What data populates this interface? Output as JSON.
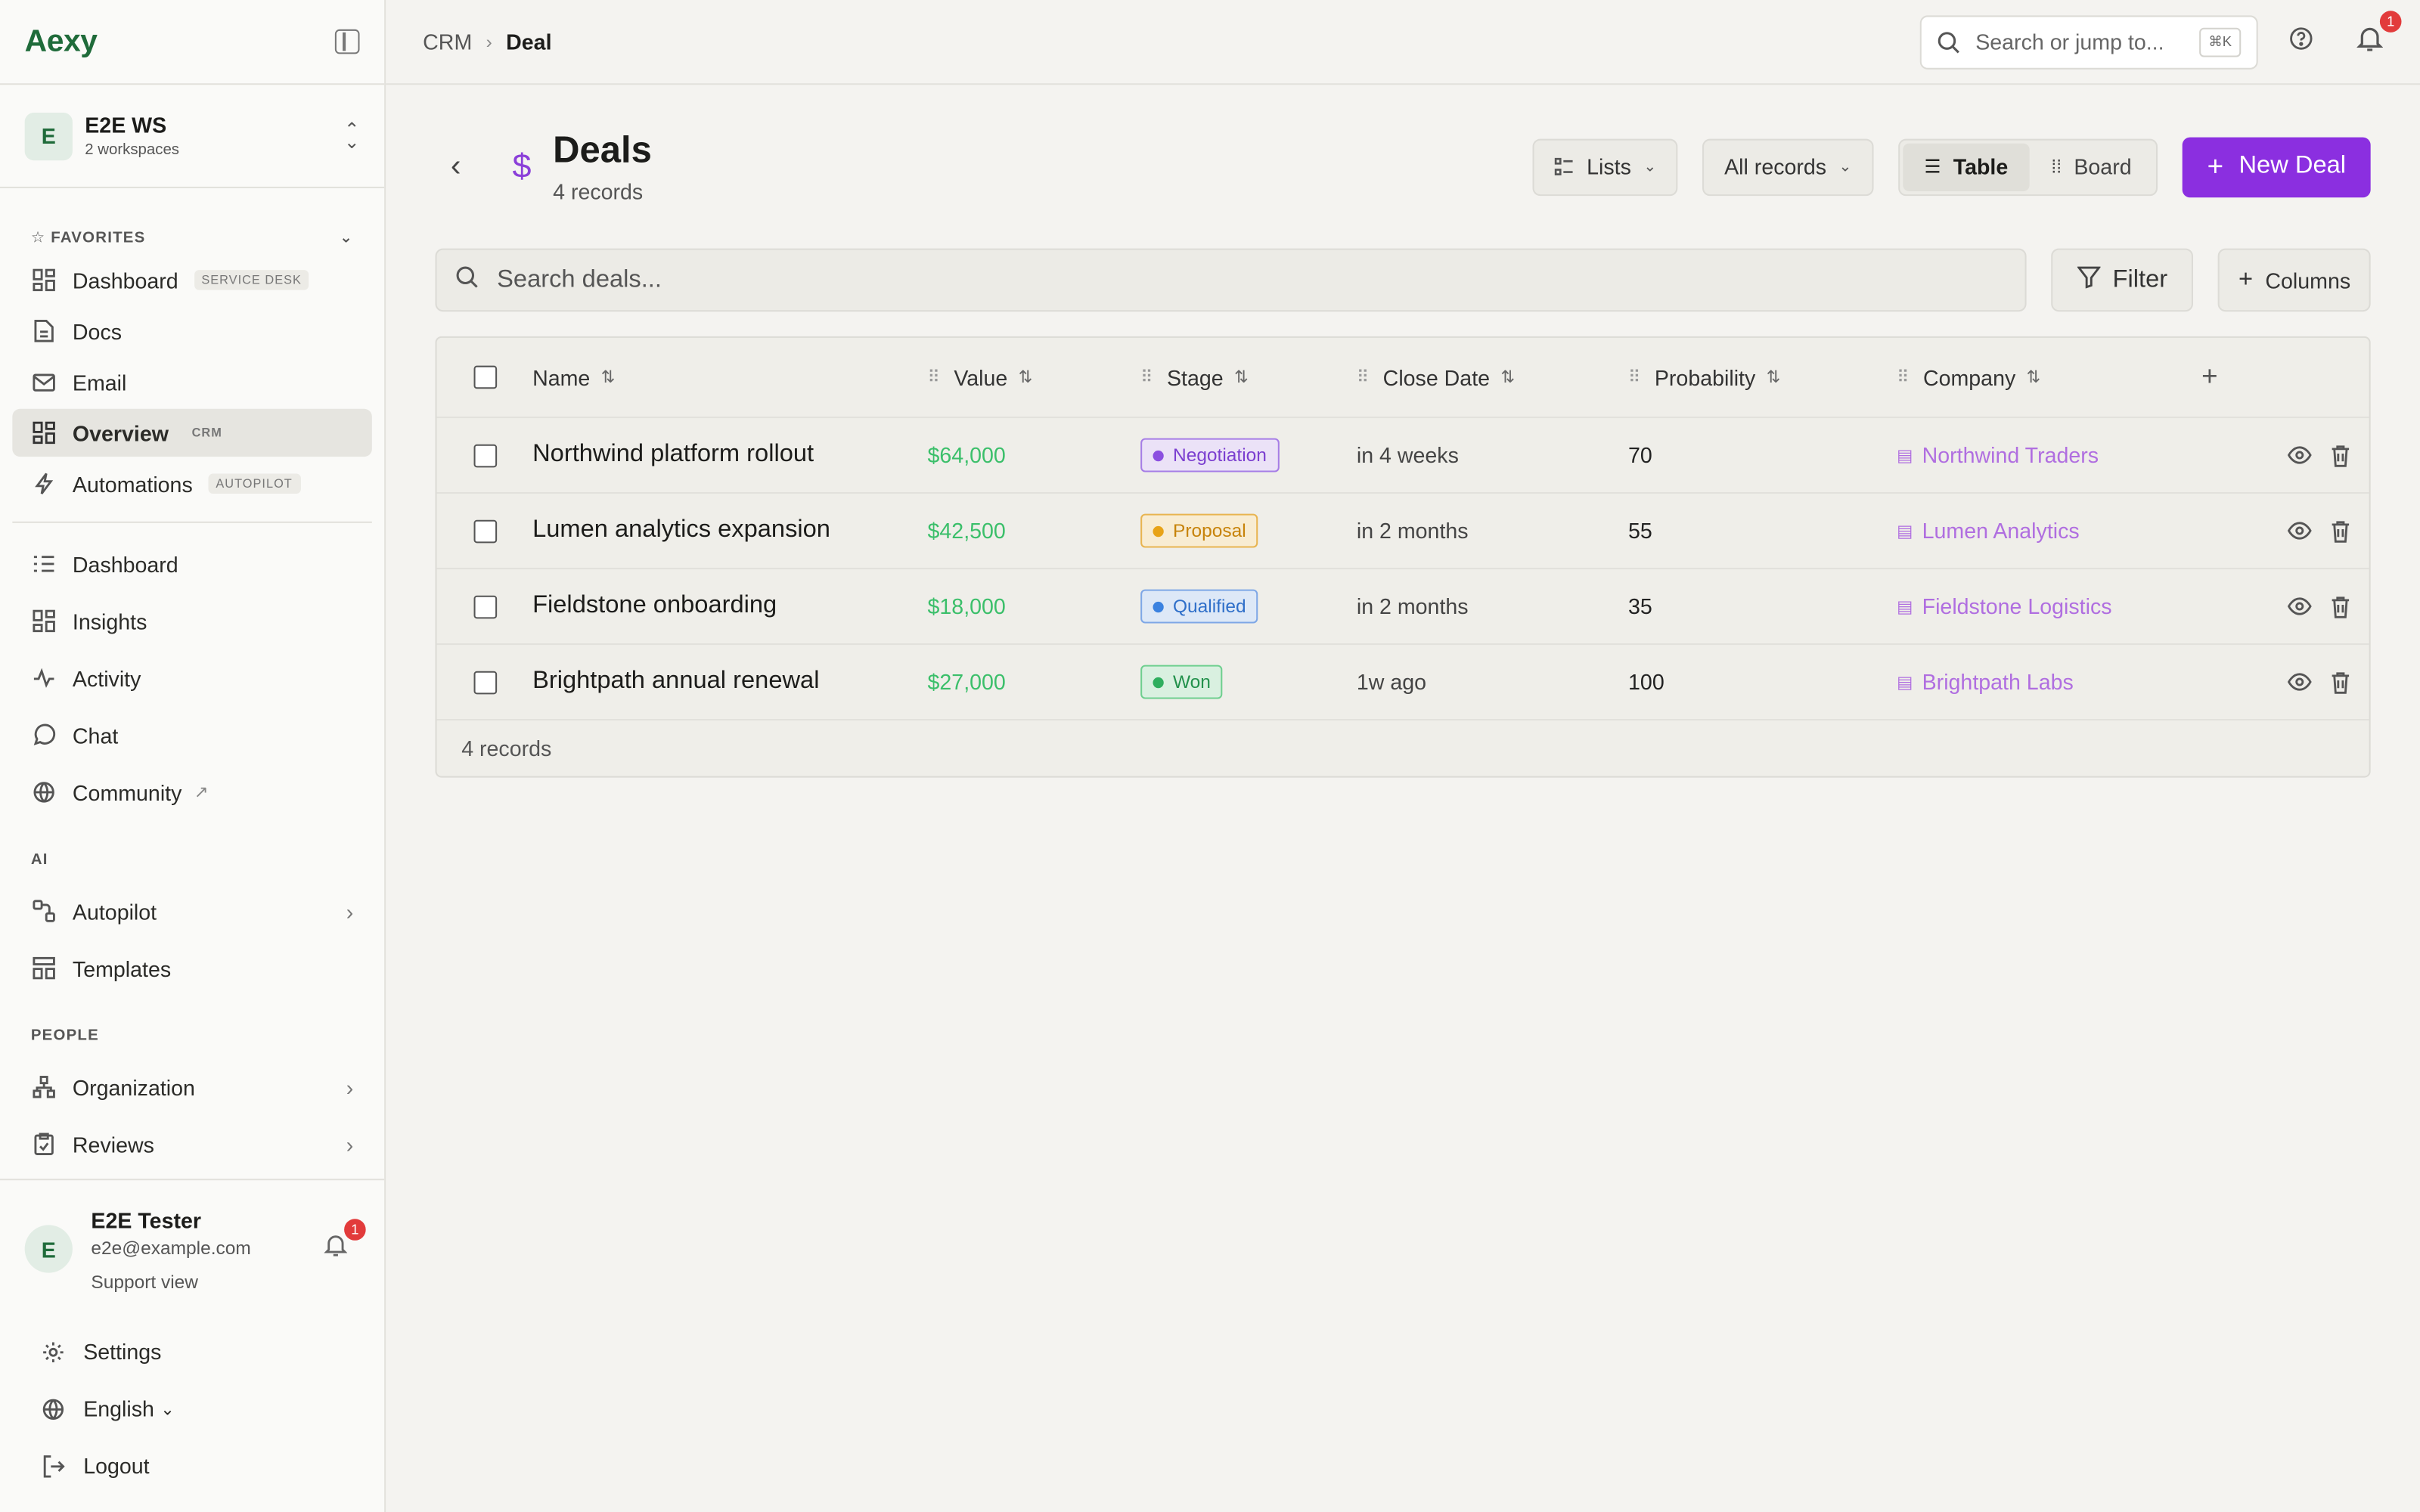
{
  "brand": "Aexy",
  "workspace": {
    "avatar": "E",
    "name": "E2E WS",
    "sub": "2 workspaces"
  },
  "favorites": {
    "heading": "FAVORITES",
    "items": [
      {
        "label": "Dashboard",
        "tag": "SERVICE DESK",
        "icon": "dashboard-grid-icon"
      },
      {
        "label": "Docs",
        "icon": "document-icon"
      },
      {
        "label": "Email",
        "icon": "mail-icon"
      },
      {
        "label": "Overview",
        "tag": "CRM",
        "icon": "overview-grid-icon",
        "active": true
      },
      {
        "label": "Automations",
        "tag": "AUTOPILOT",
        "icon": "lightning-icon"
      }
    ]
  },
  "main_nav": [
    {
      "label": "Dashboard",
      "icon": "list-icon"
    },
    {
      "label": "Insights",
      "icon": "insights-grid-icon"
    },
    {
      "label": "Activity",
      "icon": "activity-icon"
    },
    {
      "label": "Chat",
      "icon": "chat-bubble-icon"
    },
    {
      "label": "Community",
      "icon": "globe-icon",
      "external": true
    }
  ],
  "ai_section": {
    "heading": "AI",
    "items": [
      {
        "label": "Autopilot",
        "icon": "autopilot-icon",
        "chevron": true
      },
      {
        "label": "Templates",
        "icon": "templates-icon"
      }
    ]
  },
  "people_section": {
    "heading": "PEOPLE",
    "items": [
      {
        "label": "Organization",
        "icon": "org-tree-icon",
        "chevron": true
      },
      {
        "label": "Reviews",
        "icon": "clipboard-icon",
        "chevron": true
      }
    ]
  },
  "user": {
    "avatar": "E",
    "name": "E2E Tester",
    "email": "e2e@example.com",
    "role": "Support view",
    "notif_count": "1"
  },
  "footer_nav": {
    "settings": "Settings",
    "language": "English",
    "logout": "Logout"
  },
  "topbar": {
    "crumb_root": "CRM",
    "crumb_current": "Deal",
    "search_placeholder": "Search or jump to...",
    "shortcut": "⌘K",
    "notif_count": "1"
  },
  "page": {
    "title": "Deals",
    "subtitle": "4 records",
    "lists_label": "Lists",
    "records_filter": "All records",
    "view_table": "Table",
    "view_board": "Board",
    "new_button": "New Deal",
    "search_placeholder": "Search deals...",
    "filter_label": "Filter",
    "columns_label": "Columns"
  },
  "table": {
    "columns": [
      "Name",
      "Value",
      "Stage",
      "Close Date",
      "Probability",
      "Company"
    ],
    "rows": [
      {
        "name": "Northwind platform rollout",
        "value": "$64,000",
        "stage": "Negotiation",
        "close": "in 4 weeks",
        "prob": "70",
        "company": "Northwind Traders"
      },
      {
        "name": "Lumen analytics expansion",
        "value": "$42,500",
        "stage": "Proposal",
        "close": "in 2 months",
        "prob": "55",
        "company": "Lumen Analytics"
      },
      {
        "name": "Fieldstone onboarding",
        "value": "$18,000",
        "stage": "Qualified",
        "close": "in 2 months",
        "prob": "35",
        "company": "Fieldstone Logistics"
      },
      {
        "name": "Brightpath annual renewal",
        "value": "$27,000",
        "stage": "Won",
        "close": "1w ago",
        "prob": "100",
        "company": "Brightpath Labs"
      }
    ],
    "footer": "4 records"
  },
  "colors": {
    "brand": "#1f6b3a",
    "primary": "#8b2fe0",
    "value_green": "#3bbf6a",
    "company_link": "#b06ee0",
    "stage_negotiation": "#8b4fe0",
    "stage_proposal": "#e8a317",
    "stage_qualified": "#3b82e0",
    "stage_won": "#2fae5e"
  }
}
